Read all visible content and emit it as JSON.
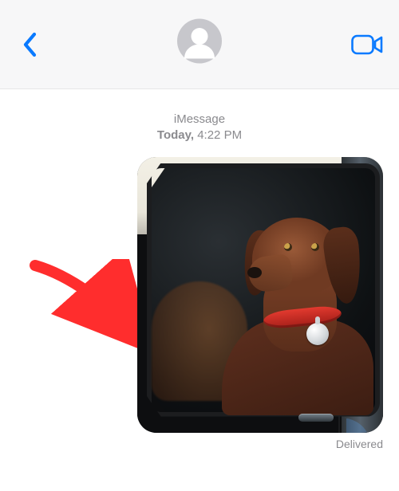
{
  "header": {
    "back_icon": "chevron-left",
    "avatar_icon": "person-circle",
    "video_icon": "video-camera"
  },
  "timestamp": {
    "service": "iMessage",
    "day": "Today,",
    "time": "4:22 PM"
  },
  "message": {
    "attachment": {
      "type": "photo",
      "subject": "dog-in-car-window",
      "collar_color": "#e23a2f",
      "tag_icon": "airtag"
    },
    "status": "Delivered"
  },
  "annotation": {
    "type": "arrow",
    "color": "#ff2d2d",
    "points_to": "message-photo"
  }
}
